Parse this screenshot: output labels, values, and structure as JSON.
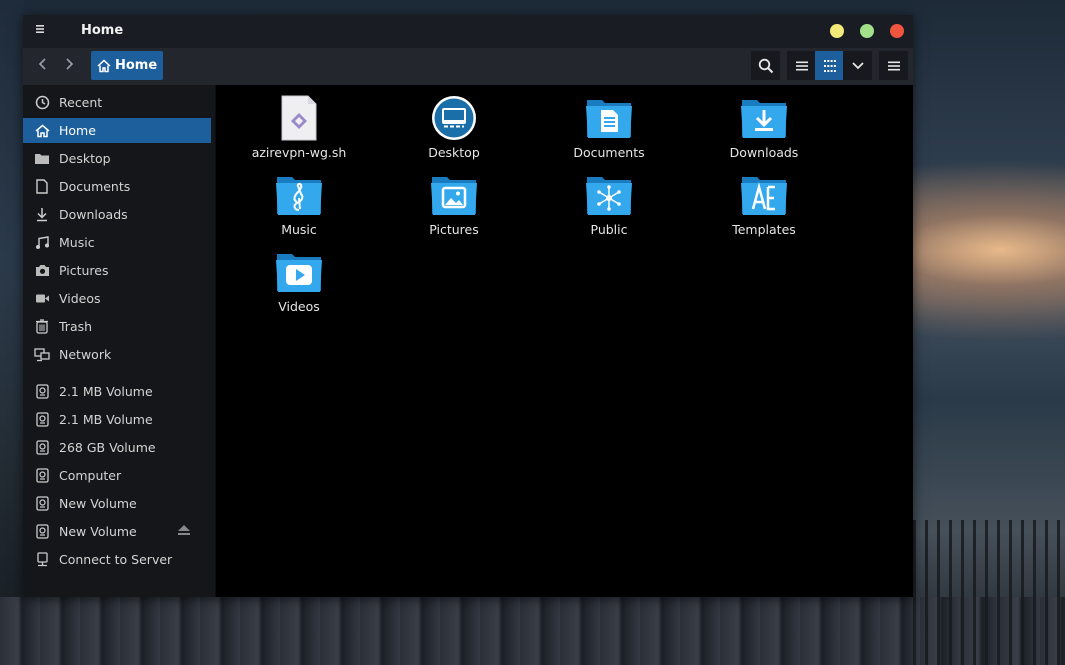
{
  "window": {
    "title": "Home"
  },
  "toolbar": {
    "breadcrumb": "Home"
  },
  "sidebar": {
    "items": [
      {
        "label": "Recent",
        "icon": "clock-icon"
      },
      {
        "label": "Home",
        "icon": "home-icon",
        "selected": true
      },
      {
        "label": "Desktop",
        "icon": "folder-icon"
      },
      {
        "label": "Documents",
        "icon": "document-icon"
      },
      {
        "label": "Downloads",
        "icon": "download-icon"
      },
      {
        "label": "Music",
        "icon": "music-icon"
      },
      {
        "label": "Pictures",
        "icon": "camera-icon"
      },
      {
        "label": "Videos",
        "icon": "video-icon"
      },
      {
        "label": "Trash",
        "icon": "trash-icon"
      },
      {
        "label": "Network",
        "icon": "network-icon"
      }
    ],
    "devices": [
      {
        "label": "2.1 MB Volume",
        "icon": "drive-icon"
      },
      {
        "label": "2.1 MB Volume",
        "icon": "drive-icon"
      },
      {
        "label": "268 GB Volume",
        "icon": "drive-icon"
      },
      {
        "label": "Computer",
        "icon": "drive-icon"
      },
      {
        "label": "New Volume",
        "icon": "drive-icon"
      },
      {
        "label": "New Volume",
        "icon": "drive-icon",
        "eject": true
      },
      {
        "label": "Connect to Server",
        "icon": "server-icon"
      }
    ]
  },
  "files": [
    {
      "label": "azirevpn-wg.sh",
      "icon": "script-file-icon"
    },
    {
      "label": "Desktop",
      "icon": "desktop-folder-icon"
    },
    {
      "label": "Documents",
      "icon": "documents-folder-icon"
    },
    {
      "label": "Downloads",
      "icon": "downloads-folder-icon"
    },
    {
      "label": "Music",
      "icon": "music-folder-icon"
    },
    {
      "label": "Pictures",
      "icon": "pictures-folder-icon"
    },
    {
      "label": "Public",
      "icon": "public-folder-icon"
    },
    {
      "label": "Templates",
      "icon": "templates-folder-icon"
    },
    {
      "label": "Videos",
      "icon": "videos-folder-icon"
    }
  ],
  "colors": {
    "accent": "#1c5f9c",
    "folder": "#2f9fe0",
    "titlebar": "#191c23",
    "sidebar": "#151619"
  }
}
